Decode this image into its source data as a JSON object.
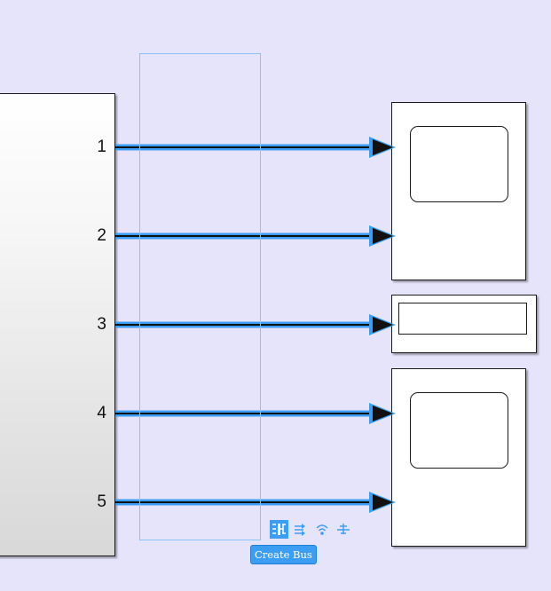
{
  "diagram": {
    "source_block": {
      "output_ports": [
        "1",
        "2",
        "3",
        "4",
        "5"
      ]
    },
    "sinks": [
      {
        "kind": "scope",
        "inputs": 2
      },
      {
        "kind": "display",
        "inputs": 1
      },
      {
        "kind": "scope",
        "inputs": 2
      }
    ],
    "signal_lines": [
      {
        "from_port": "1",
        "to": "scope-1-in1"
      },
      {
        "from_port": "2",
        "to": "scope-1-in2"
      },
      {
        "from_port": "3",
        "to": "display-in1"
      },
      {
        "from_port": "4",
        "to": "scope-2-in1"
      },
      {
        "from_port": "5",
        "to": "scope-2-in2"
      }
    ],
    "selection": {
      "active": true,
      "lines_selected": 5
    }
  },
  "action_bar": {
    "buttons": [
      {
        "icon": "create-bus-icon",
        "active": true
      },
      {
        "icon": "route-lines-icon",
        "active": false
      },
      {
        "icon": "signal-properties-icon",
        "active": false
      },
      {
        "icon": "log-signal-icon",
        "active": false
      }
    ],
    "tooltip": "Create Bus"
  },
  "colors": {
    "canvas_background": "#e6e4fb",
    "selection_highlight": "#3c9ef2",
    "selection_outline": "#86c4f4",
    "line_color": "#111111"
  }
}
